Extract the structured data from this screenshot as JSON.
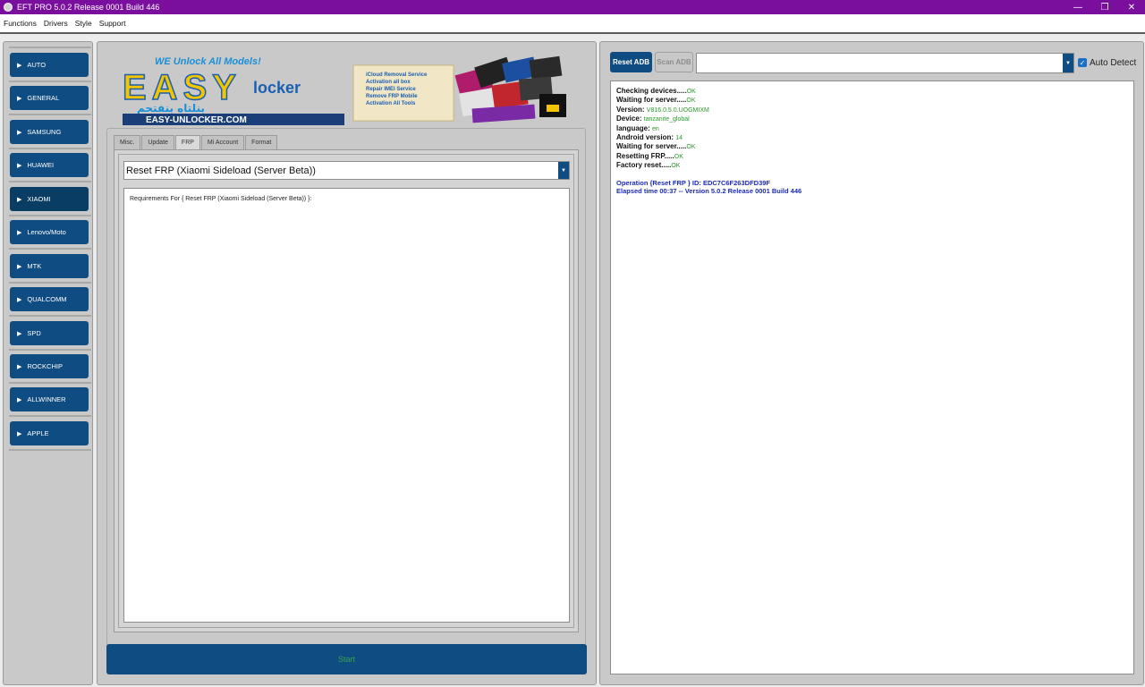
{
  "window": {
    "title": "EFT PRO 5.0.2 Release 0001 Build 446",
    "min_glyph": "—",
    "restore_glyph": "❐",
    "close_glyph": "✕"
  },
  "menu": [
    "Functions",
    "Drivers",
    "Style",
    "Support"
  ],
  "nav": [
    "AUTO",
    "GENERAL",
    "SAMSUNG",
    "HUAWEI",
    "XIAOMI",
    "Lenovo/Moto",
    "MTK",
    "QUALCOMM",
    "SPD",
    "ROCKCHIP",
    "ALLWINNER",
    "APPLE"
  ],
  "nav_active": "XIAOMI",
  "banner": {
    "top_text": "WE Unlock All Models!",
    "brand": "EASY",
    "brand_small": "locker",
    "arabic": "بنلتاه بنفتحم",
    "url": "EASY-UNLOCKER.COM",
    "services": [
      "iCloud Removal Service",
      "Activation all box",
      "Repair IMEI Service",
      "Remove FRP Mobile",
      "Activation All Tools"
    ]
  },
  "tabs": [
    "Misc.",
    "Update",
    "FRP",
    "Mi Account",
    "Format"
  ],
  "tab_active": "FRP",
  "frp": {
    "selected_operation": "Reset FRP  (Xiaomi Sideload (Server Beta))",
    "requirements": "Requirements For { Reset FRP  (Xiaomi Sideload (Server Beta)) }:"
  },
  "start_label": "Start",
  "adb": {
    "reset_label": "Reset ADB",
    "scan_label": "Scan ADB",
    "device_value": "",
    "auto_detect_label": "Auto Detect",
    "auto_detect_checked": true
  },
  "log": [
    {
      "k": "Checking devices.....",
      "v": "OK"
    },
    {
      "k": "Waiting for server.....",
      "v": "OK"
    },
    {
      "k": "Version: ",
      "v": "V816.0.5.0.UOGMIXM"
    },
    {
      "k": "Device: ",
      "v": "tanzanite_global"
    },
    {
      "k": "language: ",
      "v": "en"
    },
    {
      "k": "Android version: ",
      "v": "14"
    },
    {
      "k": "Waiting for server.....",
      "v": "OK"
    },
    {
      "k": "Resetting FRP.....",
      "v": "OK"
    },
    {
      "k": "Factory reset.....",
      "v": "OK"
    }
  ],
  "log_summary": [
    "Operation {Reset FRP } ID: EDC7C6F263DFD39F",
    "Elapsed time 00:37 -- Version 5.0.2 Release 0001 Build 446"
  ],
  "colors": {
    "title_bar": "#7a0f9e",
    "nav_button": "#0f4c81",
    "ok_text": "#2a9a2a",
    "operation_text": "#1c2bb8",
    "start_text": "#3aa44a"
  }
}
